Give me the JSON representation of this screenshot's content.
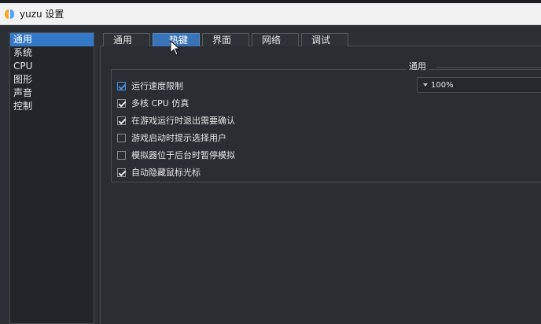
{
  "window": {
    "title": "yuzu 设置",
    "logo": "yuzu-logo-icon"
  },
  "sidebar": {
    "items": [
      {
        "label": "通用",
        "selected": true
      },
      {
        "label": "系统",
        "selected": false
      },
      {
        "label": "CPU",
        "selected": false
      },
      {
        "label": "图形",
        "selected": false
      },
      {
        "label": "声音",
        "selected": false
      },
      {
        "label": "控制",
        "selected": false
      }
    ]
  },
  "tabs": [
    {
      "label": "通用",
      "selected": false
    },
    {
      "label": "热键",
      "selected": true
    },
    {
      "label": "界面",
      "selected": false
    },
    {
      "label": "网络",
      "selected": false
    },
    {
      "label": "调试",
      "selected": false
    }
  ],
  "group": {
    "title": "通用",
    "speed_limit_value": "100%",
    "options": [
      {
        "label": "运行速度限制",
        "checked": true,
        "accent": true
      },
      {
        "label": "多核 CPU 仿真",
        "checked": true,
        "accent": false
      },
      {
        "label": "在游戏运行时退出需要确认",
        "checked": true,
        "accent": false
      },
      {
        "label": "游戏启动时提示选择用户",
        "checked": false,
        "accent": false
      },
      {
        "label": "模拟器位于后台时暂停模拟",
        "checked": false,
        "accent": false
      },
      {
        "label": "自动隐藏鼠标光标",
        "checked": true,
        "accent": false
      }
    ]
  },
  "colors": {
    "accent": "#3479c9",
    "background": "#2c2f34"
  }
}
